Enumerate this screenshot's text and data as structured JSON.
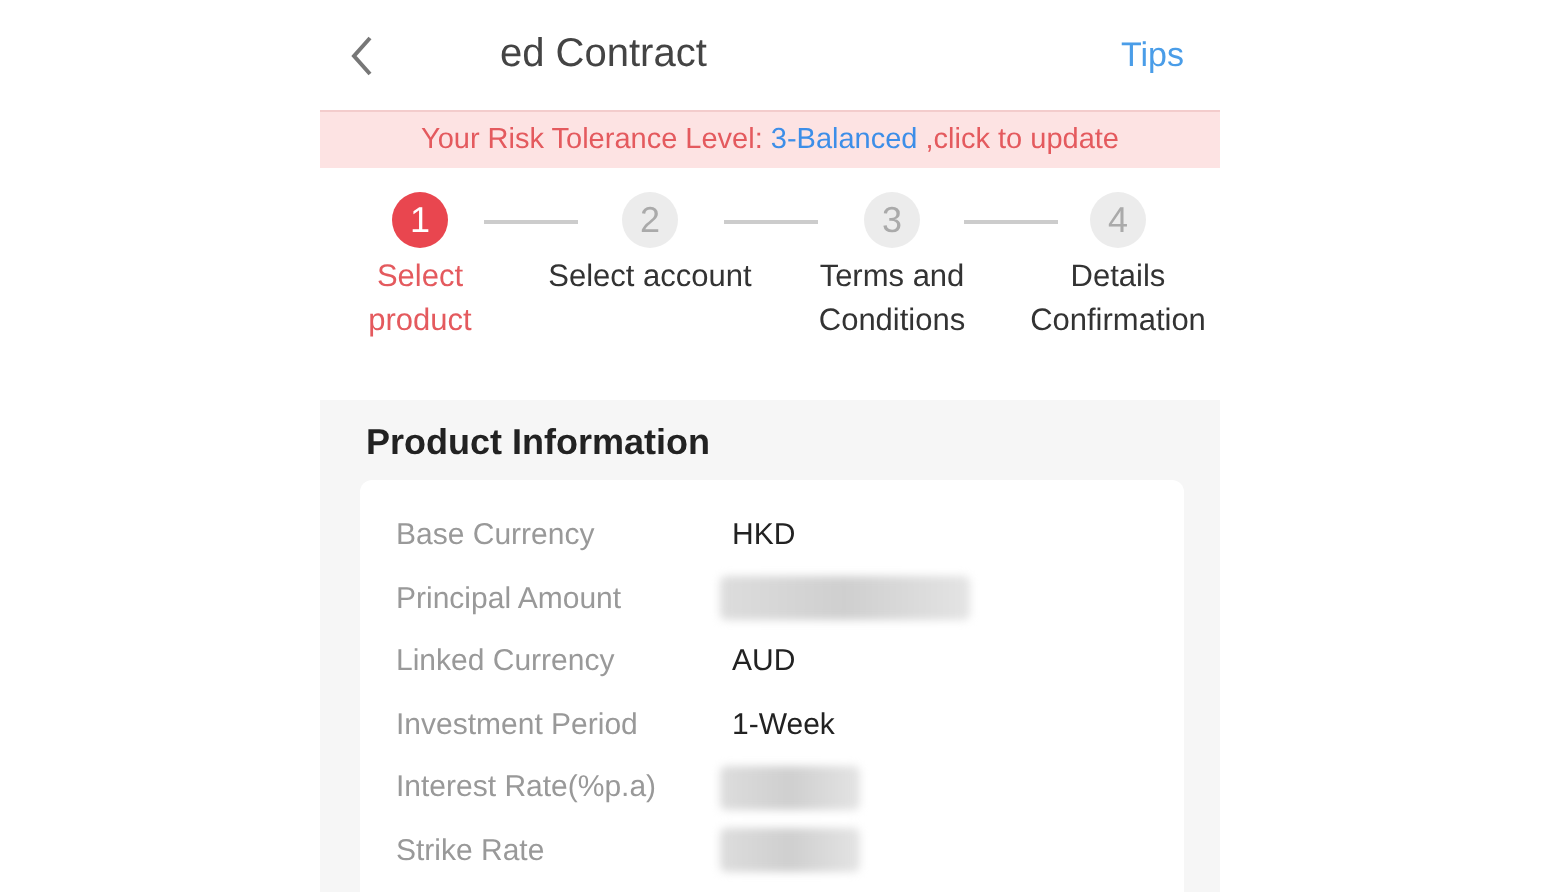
{
  "header": {
    "title": "ed Contract",
    "action": "Tips"
  },
  "banner": {
    "text": "Your Risk Tolerance Level: ",
    "link": "3-Balanced",
    "suffix": " ,click to update"
  },
  "steps": [
    {
      "number": "1",
      "label": "Select product",
      "selected": true
    },
    {
      "number": "2",
      "label": "Select account",
      "selected": false
    },
    {
      "number": "3",
      "label": "Terms and Conditions",
      "selected": false
    },
    {
      "number": "4",
      "label": "Details Confirmation",
      "selected": false
    }
  ],
  "product_information": {
    "title": "Product Information",
    "rows": [
      {
        "label": "Base Currency",
        "kind": "text",
        "value": "HKD"
      },
      {
        "label": "Principal Amount",
        "kind": "blurred"
      },
      {
        "label": "Linked Currency",
        "kind": "text",
        "value": "AUD"
      },
      {
        "label": "Investment Period",
        "kind": "text",
        "value": "1-Week"
      },
      {
        "label": "Interest Rate(%p.a)",
        "kind": "blurred"
      },
      {
        "label": "Strike Rate",
        "kind": "blurred"
      }
    ]
  }
}
